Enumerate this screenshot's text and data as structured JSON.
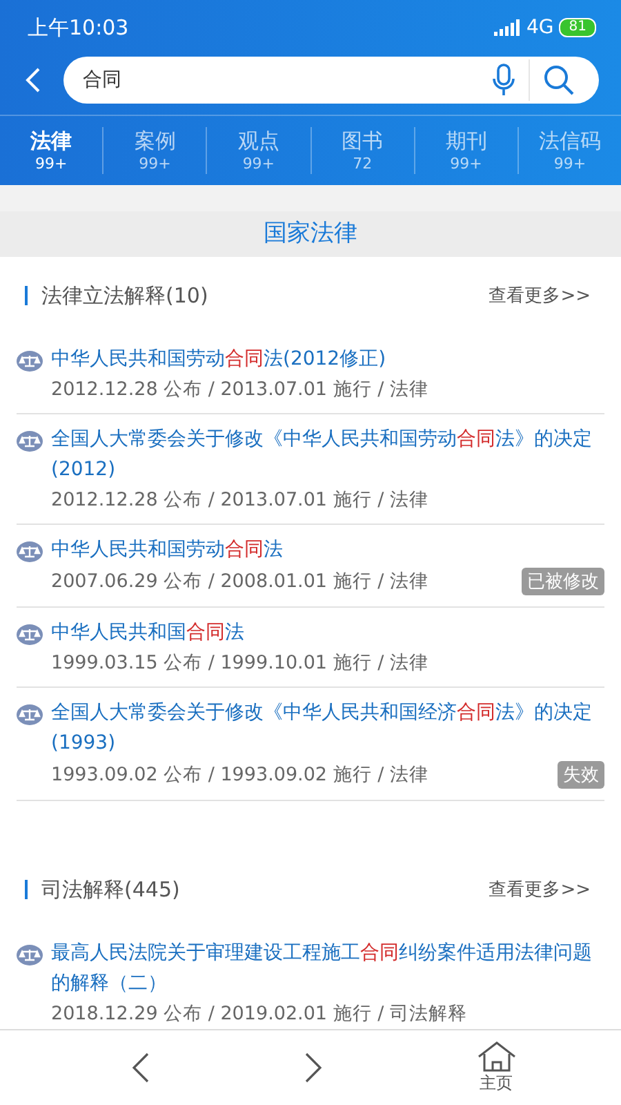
{
  "status_bar": {
    "time": "上午10:03",
    "network": "4G",
    "battery": "81"
  },
  "search": {
    "value": "合同"
  },
  "tabs": [
    {
      "label": "法律",
      "count": "99+",
      "selected": true
    },
    {
      "label": "案例",
      "count": "99+",
      "selected": false
    },
    {
      "label": "观点",
      "count": "99+",
      "selected": false
    },
    {
      "label": "图书",
      "count": "72",
      "selected": false
    },
    {
      "label": "期刊",
      "count": "99+",
      "selected": false
    },
    {
      "label": "法信码",
      "count": "99+",
      "selected": false
    }
  ],
  "category_title": "国家法律",
  "sections": [
    {
      "title": "法律立法解释(10)",
      "more": "查看更多>>",
      "items": [
        {
          "title": [
            {
              "text": "中华人民共和国劳动",
              "highlight": false
            },
            {
              "text": "合同",
              "highlight": true
            },
            {
              "text": "法(2012修正)",
              "highlight": false
            }
          ],
          "meta": "2012.12.28 公布 / 2013.07.01 施行 / 法律"
        },
        {
          "title": [
            {
              "text": "全国人大常委会关于修改《中华人民共和国劳动",
              "highlight": false
            },
            {
              "text": "合同",
              "highlight": true
            },
            {
              "text": "法》的决定(2012)",
              "highlight": false
            }
          ],
          "meta": "2012.12.28 公布 / 2013.07.01 施行 / 法律"
        },
        {
          "title": [
            {
              "text": "中华人民共和国劳动",
              "highlight": false
            },
            {
              "text": "合同",
              "highlight": true
            },
            {
              "text": "法",
              "highlight": false
            }
          ],
          "meta": "2007.06.29 公布 / 2008.01.01 施行 / 法律",
          "badge": "已被修改"
        },
        {
          "title": [
            {
              "text": "中华人民共和国",
              "highlight": false
            },
            {
              "text": "合同",
              "highlight": true
            },
            {
              "text": "法",
              "highlight": false
            }
          ],
          "meta": "1999.03.15 公布 / 1999.10.01 施行 / 法律"
        },
        {
          "title": [
            {
              "text": "全国人大常委会关于修改《中华人民共和国经济",
              "highlight": false
            },
            {
              "text": "合同",
              "highlight": true
            },
            {
              "text": "法》的决定(1993)",
              "highlight": false
            }
          ],
          "meta": "1993.09.02 公布 / 1993.09.02 施行 / 法律",
          "badge": "失效"
        }
      ]
    },
    {
      "title": "司法解释(445)",
      "more": "查看更多>>",
      "items": [
        {
          "title": [
            {
              "text": "最高人民法院关于审理建设工程施工",
              "highlight": false
            },
            {
              "text": "合同",
              "highlight": true
            },
            {
              "text": "纠纷案件适用法律问题的解释（二）",
              "highlight": false
            }
          ],
          "meta": "2018.12.29 公布 / 2019.02.01 施行 / 司法解释"
        }
      ]
    }
  ],
  "bottom_nav": {
    "home_label": "主页"
  }
}
